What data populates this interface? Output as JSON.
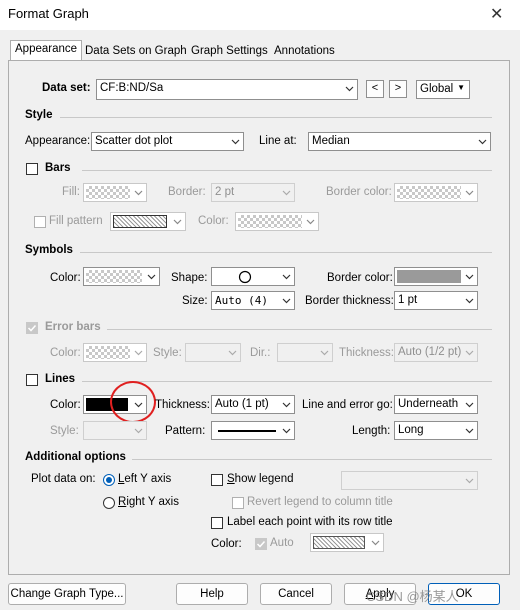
{
  "window": {
    "title": "Format Graph",
    "close": "✕"
  },
  "tabs": [
    {
      "label": "Appearance"
    },
    {
      "label": "Data Sets on Graph"
    },
    {
      "label": "Graph Settings"
    },
    {
      "label": "Annotations"
    }
  ],
  "dataset": {
    "label": "Data set:",
    "value": "CF:B:ND/Sa",
    "prev": "<",
    "next": ">",
    "scope": "Global"
  },
  "style": {
    "header": "Style",
    "appearance_label": "Appearance:",
    "appearance_value": "Scatter dot plot",
    "line_at_label": "Line at:",
    "line_at_value": "Median"
  },
  "bars": {
    "header": "Bars",
    "fill_label": "Fill:",
    "border_label": "Border:",
    "border_value": "2 pt",
    "border_color_label": "Border color:",
    "fill_pattern_label": "Fill pattern",
    "color_label": "Color:"
  },
  "symbols": {
    "header": "Symbols",
    "color_label": "Color:",
    "shape_label": "Shape:",
    "border_color_label": "Border color:",
    "size_label": "Size:",
    "size_value": "Auto (4)",
    "border_thickness_label": "Border thickness:",
    "border_thickness_value": "1 pt"
  },
  "error_bars": {
    "header": "Error bars",
    "color_label": "Color:",
    "style_label": "Style:",
    "dir_label": "Dir.:",
    "thickness_label": "Thickness:",
    "thickness_value": "Auto (1/2 pt)"
  },
  "lines": {
    "header": "Lines",
    "color_label": "Color:",
    "thickness_label": "Thickness:",
    "thickness_value": "Auto (1 pt)",
    "line_error_label": "Line and error go:",
    "line_error_value": "Underneath",
    "style_label": "Style:",
    "pattern_label": "Pattern:",
    "length_label": "Length:",
    "length_value": "Long"
  },
  "additional": {
    "header": "Additional options",
    "plot_on_label": "Plot data on:",
    "left_axis_pre": "",
    "left_axis_u": "L",
    "left_axis_post": "eft Y axis",
    "right_axis_u": "R",
    "right_axis_post": "ight  Y axis",
    "show_legend_pre": "",
    "show_legend_u": "S",
    "show_legend_post": "how legend",
    "revert_legend": "Revert legend to column title",
    "label_each": "Label each point with its row title",
    "color_label": "Color:",
    "auto_label": "Auto"
  },
  "footer": {
    "change_type": "Change Graph Type...",
    "help": "Help",
    "cancel": "Cancel",
    "apply_u": "A",
    "apply_post": "pply",
    "ok": "OK"
  },
  "watermark": "CSDN @杨某人",
  "colors": {
    "accent": "#005fb8",
    "highlight_circle": "#e02020",
    "line_color": "#000000",
    "symbol_border_color": "#9a9a9a"
  }
}
